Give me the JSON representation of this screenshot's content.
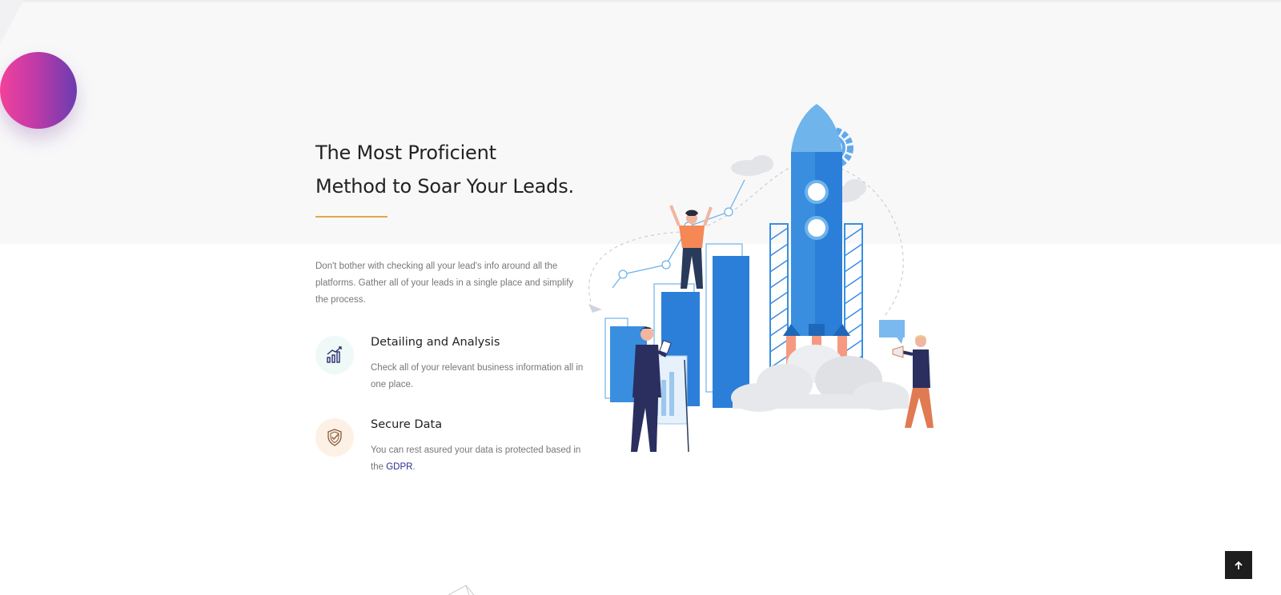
{
  "hero": {
    "title_line1": "The Most Proficient",
    "title_line2": "Method to Soar Your Leads.",
    "intro": "Don't bother with checking all your lead's info around all the platforms. Gather all of your leads in a single place and simplify the process."
  },
  "features": [
    {
      "icon": "growth-chart-icon",
      "title": "Detailing and Analysis",
      "text": "Check all of your relevant business information all in one place."
    },
    {
      "icon": "shield-check-icon",
      "title": "Secure Data",
      "text_before_link": "You can rest asured your data is protected based in the ",
      "link": "GDPR",
      "text_after_link": "."
    }
  ],
  "back_to_top": {
    "icon": "arrow-up-icon",
    "glyph": "🠕"
  },
  "colors": {
    "accent_underline": "#e3a64a",
    "link": "#2a2f8f",
    "gradient_start": "#f2419b",
    "gradient_end": "#6a3cb0",
    "illustration_blue": "#2c7fd8"
  }
}
